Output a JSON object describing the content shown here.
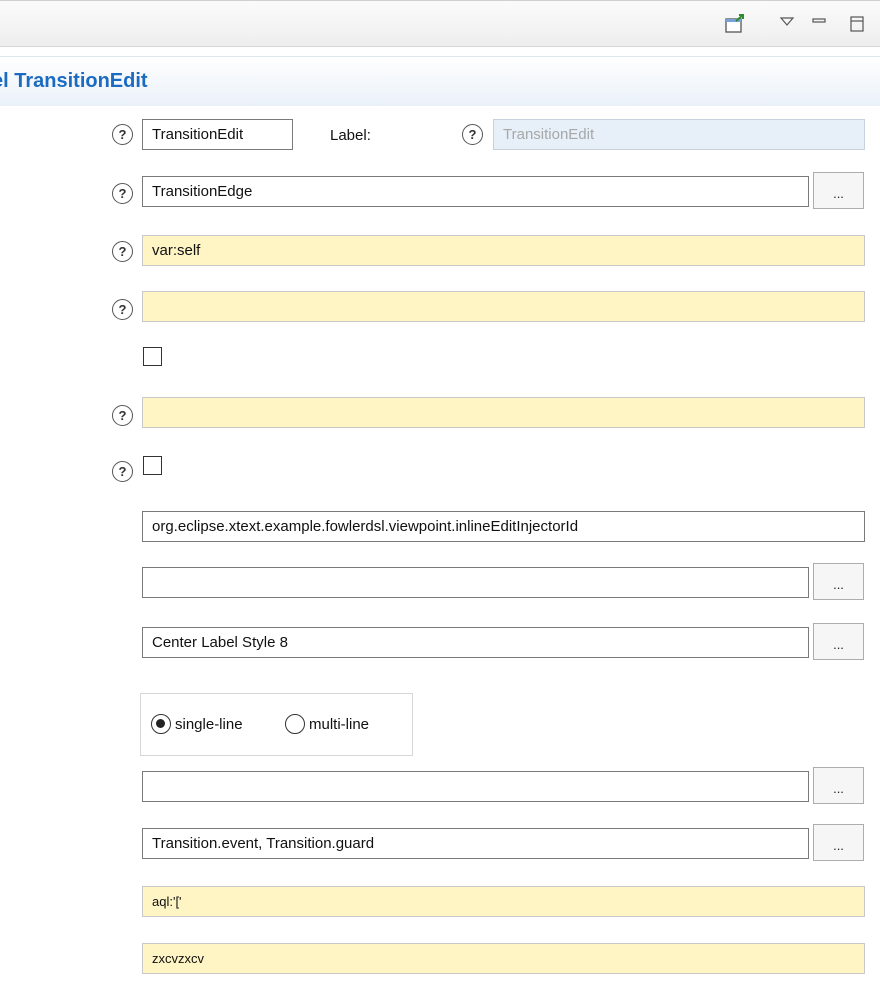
{
  "toolbar": {
    "icons": [
      "new-window-icon",
      "view-menu-icon",
      "minimize-icon",
      "maximize-icon"
    ]
  },
  "section": {
    "title": "el TransitionEdit"
  },
  "form": {
    "id_value": "TransitionEdit",
    "label_caption": "Label:",
    "label_value": "TransitionEdit",
    "domain_class_value": "TransitionEdge",
    "semantic_candidates_expression": "var:self",
    "precondition_expression": "",
    "synchronization_checked": false,
    "finish_label_expression": "",
    "direct_edit_checked": false,
    "injector_id": "org.eclipse.xtext.example.fowlerdsl.viewpoint.inlineEditInjectorId",
    "edit_label_tool": "",
    "label_style": "Center Label Style 8",
    "editor_mode": {
      "options": [
        "single-line",
        "multi-line"
      ],
      "selected": "single-line"
    },
    "reference_field_1": "",
    "features": "Transition.event, Transition.guard",
    "expression_1": "aql:'['",
    "expression_2": "zxcvzxcv"
  },
  "ui": {
    "browse_label": "...",
    "help_symbol": "?"
  }
}
